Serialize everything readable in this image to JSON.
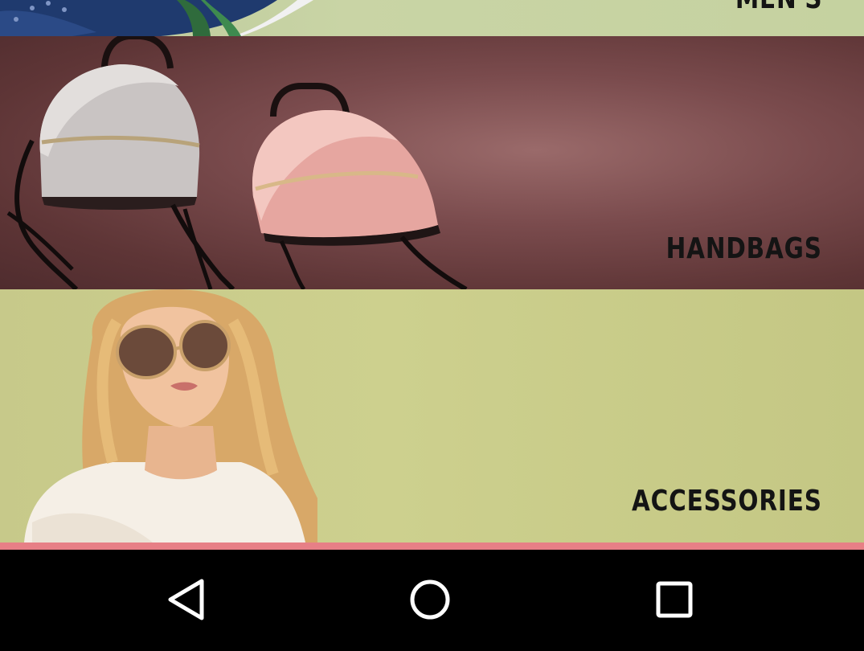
{
  "banners": {
    "mens": {
      "label": "MEN'S"
    },
    "handbags": {
      "label": "HANDBAGS"
    },
    "accessories": {
      "label": "ACCESSORIES"
    }
  },
  "colors": {
    "accent_bar": "#e77f86",
    "nav_bar": "#000000",
    "handbags_bg": "#6b3f41",
    "accessories_bg": "#cacd8b"
  },
  "nav": {
    "back_icon": "back-triangle-icon",
    "home_icon": "home-circle-icon",
    "recents_icon": "recents-square-icon"
  }
}
